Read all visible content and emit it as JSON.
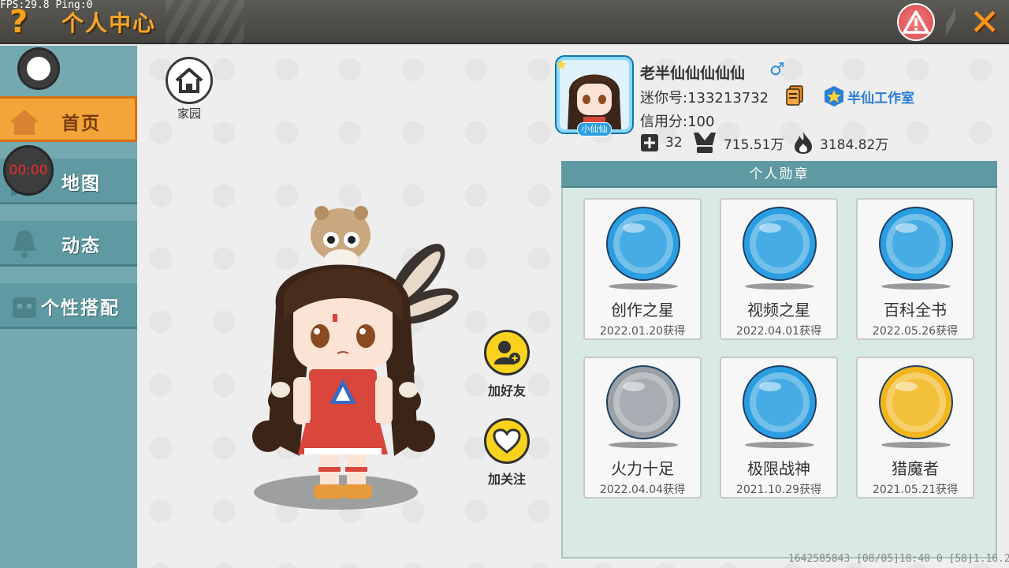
{
  "debug": {
    "fps": "FPS:29.8  Ping:0"
  },
  "header": {
    "title": "个人中心",
    "help_icon": "question-mark-icon",
    "report_icon": "warning-icon",
    "close_icon": "close-icon"
  },
  "sidebar": {
    "items": [
      {
        "label": "首页",
        "icon": "house-icon",
        "active": true
      },
      {
        "label": "地图",
        "icon": "map-icon",
        "active": false
      },
      {
        "label": "动态",
        "icon": "bell-icon",
        "active": false
      },
      {
        "label": "个性搭配",
        "icon": "outfit-icon",
        "active": false
      }
    ],
    "timer": "00:00"
  },
  "home": {
    "label": "家园"
  },
  "actions": {
    "add_friend": "加好友",
    "follow": "加关注"
  },
  "profile": {
    "name": "老半仙仙仙仙仙",
    "gender": "♂",
    "id_text": "迷你号:133213732",
    "studio": "半仙工作室",
    "credit": "信用分:100",
    "avatar_tag": "小仙仙",
    "stats": [
      {
        "icon": "plus-square-icon",
        "value": "32"
      },
      {
        "icon": "trophy-icon",
        "value": "715.51万"
      },
      {
        "icon": "fire-icon",
        "value": "3184.82万"
      }
    ]
  },
  "medals": {
    "header": "个人勋章",
    "items": [
      {
        "name": "创作之星",
        "date": "2022.01.20获得",
        "color": "#2a9ee0"
      },
      {
        "name": "视频之星",
        "date": "2022.04.01获得",
        "color": "#2a9ee0"
      },
      {
        "name": "百科全书",
        "date": "2022.05.26获得",
        "color": "#2a9ee0"
      },
      {
        "name": "火力十足",
        "date": "2022.04.04获得",
        "color": "#9aa0a6"
      },
      {
        "name": "极限战神",
        "date": "2021.10.29获得",
        "color": "#2a9ee0"
      },
      {
        "name": "猎魔者",
        "date": "2021.05.21获得",
        "color": "#f2b51c"
      }
    ]
  },
  "footer": {
    "info": "1642585843  [08/05]18:40 0  [58]1.16.2"
  }
}
